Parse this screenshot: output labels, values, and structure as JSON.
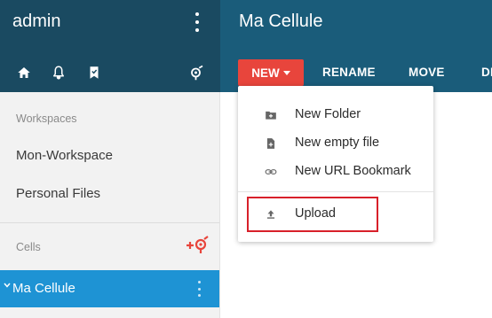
{
  "sidebar": {
    "user_name": "admin",
    "header_icons": [
      "home-icon",
      "bell-icon",
      "bookmark-icon",
      "pydio-logo-icon"
    ],
    "workspaces_label": "Workspaces",
    "workspaces": [
      {
        "label": "Mon-Workspace"
      },
      {
        "label": "Personal Files"
      }
    ],
    "cells_label": "Cells",
    "active_cell": {
      "label": "Ma Cellule"
    }
  },
  "header": {
    "title": "Ma Cellule",
    "new_label": "NEW",
    "rename_label": "RENAME",
    "move_label": "MOVE",
    "truncated_label": "DI"
  },
  "new_menu": {
    "items": [
      {
        "label": "New Folder",
        "icon": "folder-plus-icon"
      },
      {
        "label": "New empty file",
        "icon": "file-plus-icon"
      },
      {
        "label": "New URL Bookmark",
        "icon": "link-icon"
      }
    ],
    "upload": {
      "label": "Upload",
      "icon": "upload-icon"
    }
  },
  "colors": {
    "sidebar_header": "#1a4a61",
    "main_header": "#1a5c7a",
    "new_button": "#e8453c",
    "active_cell": "#1e93d4",
    "highlight": "#d8202a"
  }
}
